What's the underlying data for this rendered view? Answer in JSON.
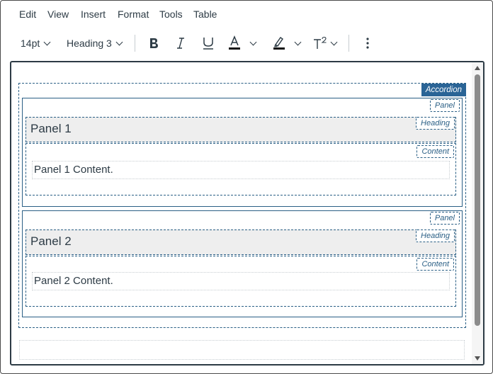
{
  "menu": [
    "Edit",
    "View",
    "Insert",
    "Format",
    "Tools",
    "Table"
  ],
  "toolbar": {
    "font_size": "14pt",
    "block_format": "Heading 3",
    "bold_icon": "bold-icon",
    "italic_icon": "italic-icon",
    "underline_icon": "underline-icon",
    "text_color_icon": "text-color-icon",
    "highlight_icon": "highlight-icon",
    "superscript_icon": "superscript-icon",
    "more_icon": "more-vertical-icon"
  },
  "accordion": {
    "tag": "Accordion",
    "panels": [
      {
        "tag": "Panel",
        "heading_tag": "Heading",
        "content_tag": "Content",
        "heading": "Panel 1",
        "content": "Panel 1 Content."
      },
      {
        "tag": "Panel",
        "heading_tag": "Heading",
        "content_tag": "Content",
        "heading": "Panel 2",
        "content": "Panel 2 Content."
      }
    ]
  },
  "colors": {
    "accent": "#2a6496",
    "text": "#2d3b45"
  }
}
